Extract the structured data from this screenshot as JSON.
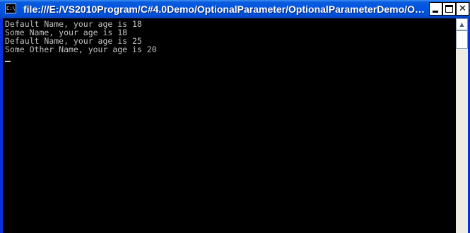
{
  "window": {
    "title": "file:///E:/VS2010Program/C#4.0Demo/OptionalParameter/OptionalParameterDemo/Optiona...",
    "app_icon": "console-icon",
    "app_icon_text": "C:\\"
  },
  "titlebar_buttons": {
    "minimize": "minimize-icon",
    "maximize": "maximize-icon",
    "close_label": "✕"
  },
  "console": {
    "lines": [
      "Default Name, your age is 18",
      "Some Name, your age is 18",
      "Default Name, your age is 25",
      "Some Other Name, your age is 20"
    ],
    "text_color": "#c0c0c0",
    "background": "#000000"
  },
  "scrollbar": {
    "up_arrow": "▲"
  }
}
